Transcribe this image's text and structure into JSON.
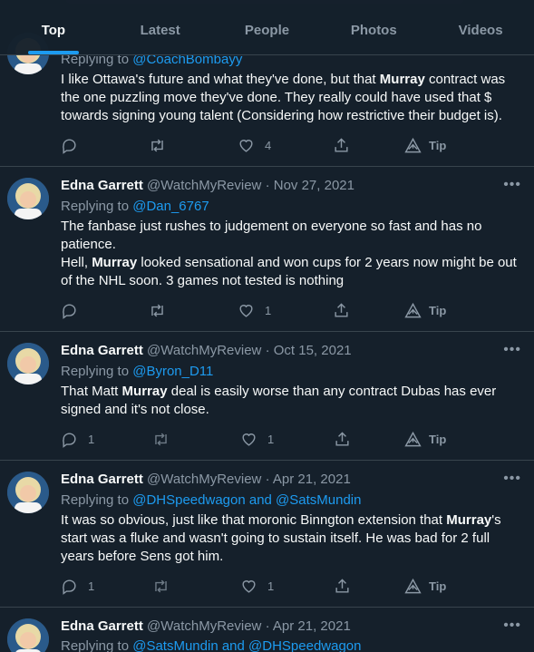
{
  "tabs": [
    "Top",
    "Latest",
    "People",
    "Photos",
    "Videos"
  ],
  "colors": {
    "background": "#15202b",
    "accent": "#1d9bf0",
    "muted": "#8b98a5",
    "divider": "#38444d"
  },
  "tip_label": "Tip",
  "tweets": [
    {
      "replying_prefix": "Replying to ",
      "replying_to": "@CoachBombayy",
      "body": [
        "I like Ottawa's future and what they've done, but that ",
        "Murray",
        " contract was the one puzzling move they've done. They really could have used that $ towards signing young talent (Considering how restrictive their budget is)."
      ],
      "reply_count": "",
      "like_count": "4"
    },
    {
      "name": "Edna Garrett",
      "handle": "@WatchMyReview",
      "sep": "·",
      "date": "Nov 27, 2021",
      "replying_prefix": "Replying to ",
      "replying_to": "@Dan_6767",
      "body": [
        "The fanbase just rushes to judgement on everyone so fast and has no patience."
      ],
      "body2": [
        "Hell, ",
        "Murray",
        " looked sensational and won cups for 2 years now might be out of the NHL soon. 3 games not tested is nothing"
      ],
      "reply_count": "",
      "like_count": "1"
    },
    {
      "name": "Edna Garrett",
      "handle": "@WatchMyReview",
      "sep": "·",
      "date": "Oct 15, 2021",
      "replying_prefix": "Replying to ",
      "replying_to": "@Byron_D11",
      "body": [
        "That Matt ",
        "Murray",
        " deal is easily worse than any contract Dubas has ever signed and it's not close."
      ],
      "reply_count": "1",
      "like_count": "1"
    },
    {
      "name": "Edna Garrett",
      "handle": "@WatchMyReview",
      "sep": "·",
      "date": "Apr 21, 2021",
      "replying_prefix": "Replying to ",
      "replying_to": "@DHSpeedwagon and @SatsMundin",
      "body": [
        "It was so obvious, just like that moronic Binngton extension that ",
        "Murray",
        "'s start was a fluke and wasn't going to sustain itself. He was bad for 2 full years before Sens got him."
      ],
      "reply_count": "1",
      "like_count": "1"
    },
    {
      "name": "Edna Garrett",
      "handle": "@WatchMyReview",
      "sep": "·",
      "date": "Apr 21, 2021",
      "replying_prefix": "Replying to ",
      "replying_to": "@SatsMundin and @DHSpeedwagon"
    }
  ]
}
